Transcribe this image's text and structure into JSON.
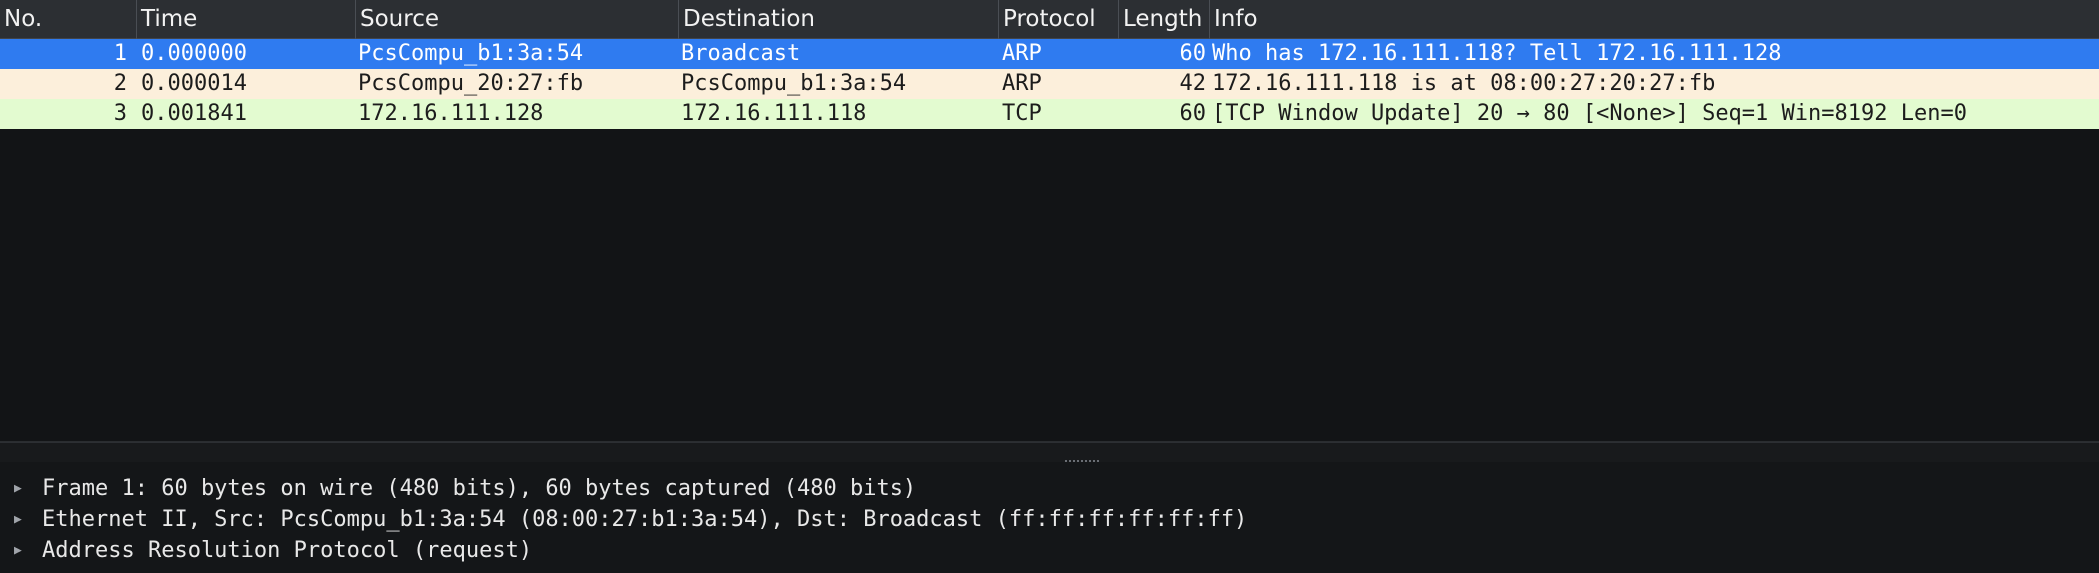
{
  "columns": {
    "no": "No.",
    "time": "Time",
    "source": "Source",
    "destination": "Destination",
    "protocol": "Protocol",
    "length": "Length",
    "info": "Info"
  },
  "packets": [
    {
      "no": "1",
      "time": "0.000000",
      "source": "PcsCompu_b1:3a:54",
      "destination": "Broadcast",
      "protocol": "ARP",
      "length": "60",
      "info": "Who has 172.16.111.118? Tell 172.16.111.128"
    },
    {
      "no": "2",
      "time": "0.000014",
      "source": "PcsCompu_20:27:fb",
      "destination": "PcsCompu_b1:3a:54",
      "protocol": "ARP",
      "length": "42",
      "info": "172.16.111.118 is at 08:00:27:20:27:fb"
    },
    {
      "no": "3",
      "time": "0.001841",
      "source": "172.16.111.128",
      "destination": "172.16.111.118",
      "protocol": "TCP",
      "length": "60",
      "info": "[TCP Window Update] 20 → 80 [<None>] Seq=1 Win=8192 Len=0"
    }
  ],
  "details": [
    {
      "icon": "chevron-right-icon",
      "text": "Frame 1: 60 bytes on wire (480 bits), 60 bytes captured (480 bits)"
    },
    {
      "icon": "chevron-right-icon",
      "text": "Ethernet II, Src: PcsCompu_b1:3a:54 (08:00:27:b1:3a:54), Dst: Broadcast (ff:ff:ff:ff:ff:ff)"
    },
    {
      "icon": "chevron-right-icon",
      "text": "Address Resolution Protocol (request)"
    }
  ],
  "colors": {
    "selected_row": "#2f7bf0",
    "arp_row": "#fcefdb",
    "tcp_row": "#e3fbd0",
    "background": "#121416"
  }
}
